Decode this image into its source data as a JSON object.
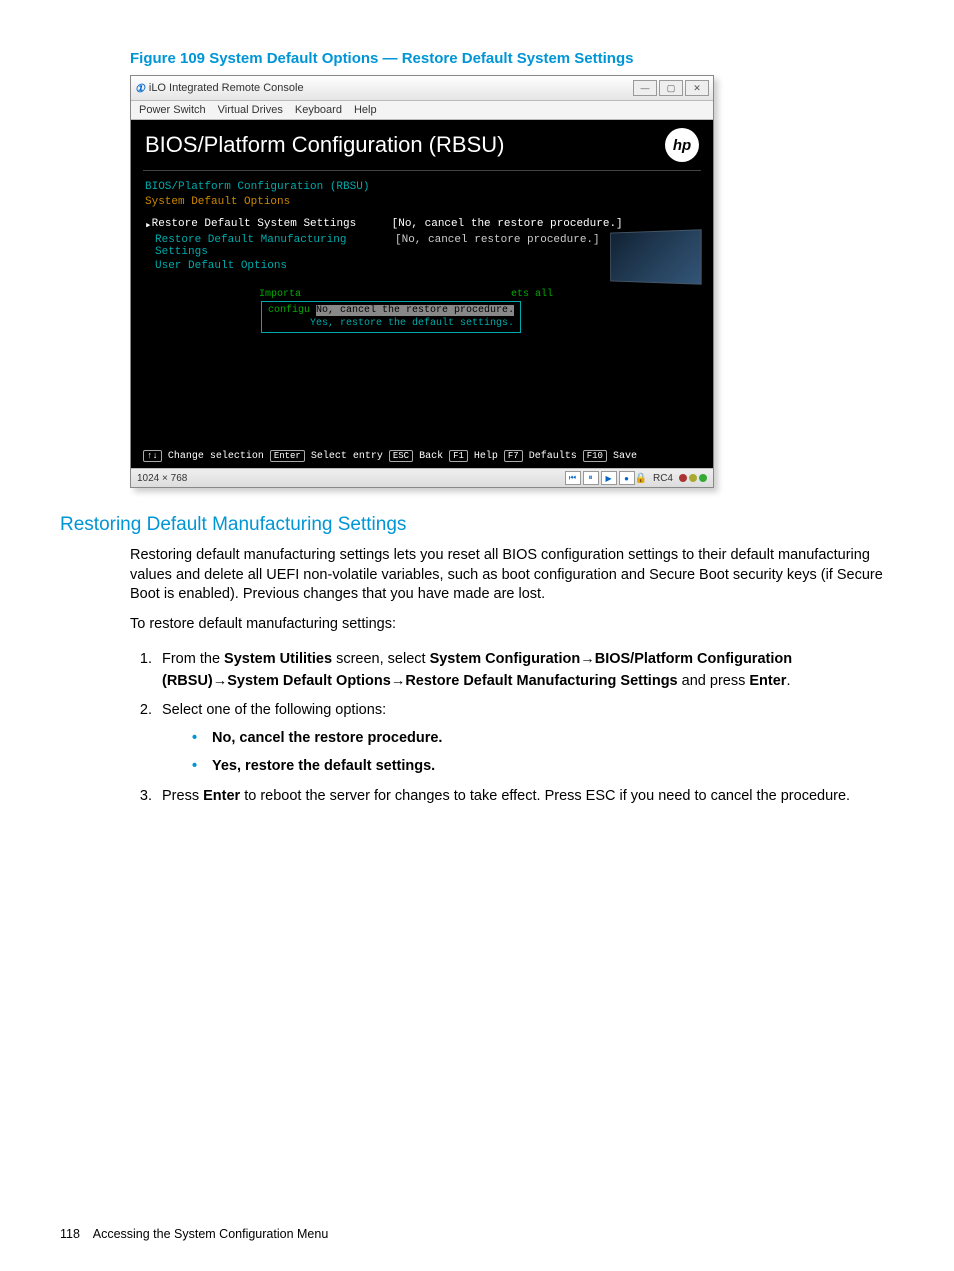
{
  "figure": {
    "caption": "Figure 109 System Default Options — Restore Default System Settings"
  },
  "screenshot": {
    "window_title": "iLO Integrated Remote Console",
    "win_min": "—",
    "win_max": "▢",
    "win_close": "✕",
    "menu": {
      "power": "Power Switch",
      "vdrives": "Virtual Drives",
      "keyboard": "Keyboard",
      "help": "Help"
    },
    "header_title": "BIOS/Platform Configuration (RBSU)",
    "hp_logo": "hp",
    "breadcrumb1": "BIOS/Platform Configuration (RBSU)",
    "breadcrumb2": "System Default Options",
    "rows": [
      {
        "label": "Restore Default System Settings",
        "value": "[No, cancel the restore procedure.]"
      },
      {
        "label": "Restore Default Manufacturing Settings",
        "value": "[No, cancel restore procedure.]"
      },
      {
        "label": "User Default Options",
        "value": ""
      }
    ],
    "popup": {
      "side_left": "Importa",
      "side_right": "ets all",
      "line0": "configu",
      "opt_selected": "No, cancel the restore procedure.",
      "opt_other": "Yes, restore the default settings."
    },
    "footer": {
      "updown": "↑↓",
      "change": "Change selection",
      "enter_key": "Enter",
      "enter_lbl": "Select entry",
      "esc_key": "ESC",
      "esc_lbl": "Back",
      "f1_key": "F1",
      "f1_lbl": "Help",
      "f7_key": "F7",
      "f7_lbl": "Defaults",
      "f10_key": "F10",
      "f10_lbl": "Save"
    },
    "status": {
      "resolution": "1024 × 768",
      "b1": "⏮",
      "b2": "⏸",
      "b3": "▶",
      "b4": "●",
      "lock": "🔒",
      "rc": "RC4"
    }
  },
  "section": {
    "heading": "Restoring Default Manufacturing Settings",
    "para1": "Restoring default manufacturing settings lets you reset all BIOS configuration settings to their default manufacturing values and delete all UEFI non-volatile variables, such as boot configuration and Secure Boot security keys (if Secure Boot is enabled). Previous changes that you have made are lost.",
    "para2": "To restore default manufacturing settings:",
    "step1_prefix": "From the ",
    "step1_b1": "System Utilities",
    "step1_mid1": " screen, select ",
    "step1_b2": "System Configuration",
    "arrow": "→",
    "step1_b3": "BIOS/Platform Configuration (RBSU)",
    "step1_b4": "System Default Options",
    "step1_b5": "Restore Default Manufacturing Settings",
    "step1_mid2": " and press ",
    "step1_b6": "Enter",
    "step1_end": ".",
    "step2": "Select one of the following options:",
    "bullet1": "No, cancel the restore procedure.",
    "bullet2": "Yes, restore the default settings.",
    "step3_prefix": "Press ",
    "step3_b1": "Enter",
    "step3_rest": " to reboot the server for changes to take effect. Press ESC if you need to cancel the procedure."
  },
  "footer": {
    "page": "118",
    "title": "Accessing the System Configuration Menu"
  }
}
